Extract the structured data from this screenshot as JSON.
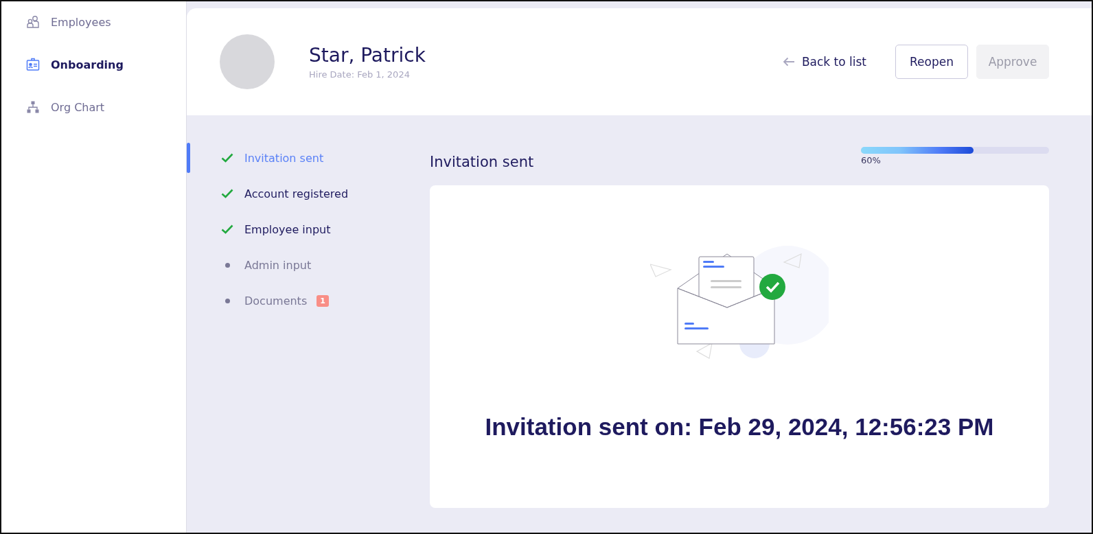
{
  "sidebar": {
    "items": [
      {
        "label": "Employees",
        "kind": "people",
        "selected": false
      },
      {
        "label": "Onboarding",
        "kind": "badge",
        "selected": true
      },
      {
        "label": "Org Chart",
        "kind": "org",
        "selected": false
      }
    ]
  },
  "header": {
    "name": "Star, Patrick",
    "hire_date": "Hire Date: Feb 1, 2024",
    "back_link": "Back to list",
    "buttons": [
      {
        "label": "Reopen",
        "disabled": false
      },
      {
        "label": "Approve",
        "disabled": true
      }
    ]
  },
  "steps": [
    {
      "label": "Invitation sent",
      "done": true,
      "selected": true
    },
    {
      "label": "Account registered",
      "done": true,
      "selected": false
    },
    {
      "label": "Employee input",
      "done": true,
      "selected": false
    },
    {
      "label": "Admin input",
      "done": false,
      "selected": false
    },
    {
      "label": "Documents",
      "done": false,
      "selected": false,
      "badge": "1"
    }
  ],
  "section": {
    "title": "Invitation sent",
    "progress": {
      "level": 0.6,
      "label": "60%"
    },
    "message": "Invitation sent on: Feb 29, 2024, 12:56:23 PM"
  }
}
